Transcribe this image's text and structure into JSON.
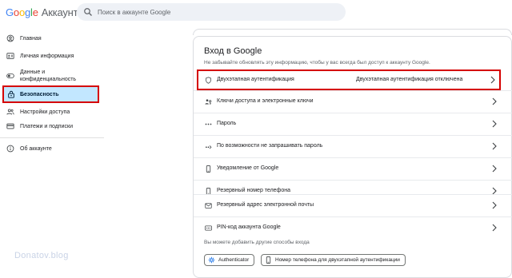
{
  "header": {
    "logo_google": [
      "G",
      "o",
      "o",
      "g",
      "l",
      "e"
    ],
    "logo_account": "Аккаунт",
    "search_placeholder": "Поиск в аккаунте Google"
  },
  "sidebar": {
    "items": [
      {
        "label": "Главная",
        "icon": "home-icon"
      },
      {
        "label": "Личная информация",
        "icon": "id-card-icon"
      },
      {
        "label": "Данные и\nконфиденциальность",
        "icon": "toggle-icon"
      },
      {
        "label": "Безопасность",
        "icon": "lock-icon",
        "active": true
      },
      {
        "label": "Настройки доступа",
        "icon": "people-icon"
      },
      {
        "label": "Платежи и подписки",
        "icon": "credit-card-icon"
      },
      {
        "label": "Об аккаунте",
        "icon": "info-icon"
      }
    ]
  },
  "signin": {
    "title": "Вход в Google",
    "subtitle": "Не забывайте обновлять эту информацию, чтобы у вас всегда был доступ к аккаунту Google.",
    "rows": [
      {
        "label": "Двухэтапная аутентификация",
        "status": "Двухэтапная аутентификация отключена",
        "icon": "shield-icon"
      },
      {
        "label": "Ключи доступа и электронные ключи",
        "status": "",
        "icon": "passkey-icon"
      },
      {
        "label": "Пароль",
        "status": "",
        "icon": "password-dots-icon"
      },
      {
        "label": "По возможности не запрашивать пароль",
        "status": "",
        "icon": "skip-password-icon"
      },
      {
        "label": "Уведомление от Google",
        "status": "",
        "icon": "phone-icon"
      },
      {
        "label": "Резервный номер телефона",
        "status": "",
        "icon": "phone-icon"
      },
      {
        "label": "Резервный адрес электронной почты",
        "status": "",
        "icon": "mail-icon"
      },
      {
        "label": "PIN-код аккаунта Google",
        "status": "",
        "icon": "pin-icon"
      }
    ],
    "hint": "Вы можете добавить другие способы входа",
    "chips": [
      {
        "label": "Authenticator",
        "icon": "authenticator-icon"
      },
      {
        "label": "Номер телефона для двухэтапной аутентификации",
        "icon": "phone-icon"
      }
    ]
  },
  "watermark": "Donatov.blog",
  "colors": {
    "active_bg": "#c2e7ff",
    "highlight_border": "#d50000",
    "search_bg": "#eef1f6"
  }
}
